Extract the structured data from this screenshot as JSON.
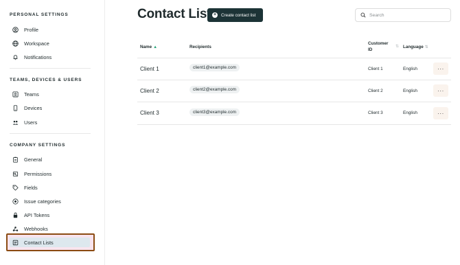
{
  "sidebar": {
    "personal_title": "PERSONAL SETTINGS",
    "personal_items": [
      {
        "label": "Profile",
        "icon": "user-circle-icon"
      },
      {
        "label": "Workspace",
        "icon": "globe-icon"
      },
      {
        "label": "Notifications",
        "icon": "bell-icon"
      }
    ],
    "teams_title": "TEAMS, DEVICES & USERS",
    "teams_items": [
      {
        "label": "Teams",
        "icon": "user-box-icon"
      },
      {
        "label": "Devices",
        "icon": "phone-icon"
      },
      {
        "label": "Users",
        "icon": "users-icon"
      }
    ],
    "company_title": "COMPANY SETTINGS",
    "company_items": [
      {
        "label": "General",
        "icon": "clipboard-icon"
      },
      {
        "label": "Permissions",
        "icon": "key-icon"
      },
      {
        "label": "Fields",
        "icon": "tag-icon"
      },
      {
        "label": "Issue categories",
        "icon": "target-icon"
      },
      {
        "label": "API Tokens",
        "icon": "lock-icon"
      },
      {
        "label": "Webhooks",
        "icon": "webhook-icon"
      },
      {
        "label": "Contact Lists",
        "icon": "contact-list-icon",
        "active": true
      }
    ]
  },
  "header": {
    "title": "Contact Lists",
    "create_label": "Create contact list",
    "search_placeholder": "Search"
  },
  "table": {
    "columns": {
      "name": "Name",
      "recipients": "Recipients",
      "customer_id_line1": "Customer",
      "customer_id_line2": "ID",
      "language": "Language"
    },
    "rows": [
      {
        "name": "Client 1",
        "recipient": "client1@example.com",
        "customer_id": "Client 1",
        "language": "English",
        "more": "···"
      },
      {
        "name": "Client 2",
        "recipient": "client2@example.com",
        "customer_id": "Client 2",
        "language": "English",
        "more": "···"
      },
      {
        "name": "Client 3",
        "recipient": "client3@example.com",
        "customer_id": "Client 3",
        "language": "English",
        "more": "···"
      }
    ]
  },
  "colors": {
    "primary_button": "#1c3336",
    "active_highlight": "#8b4b12",
    "sort_active": "#2aa57a"
  }
}
